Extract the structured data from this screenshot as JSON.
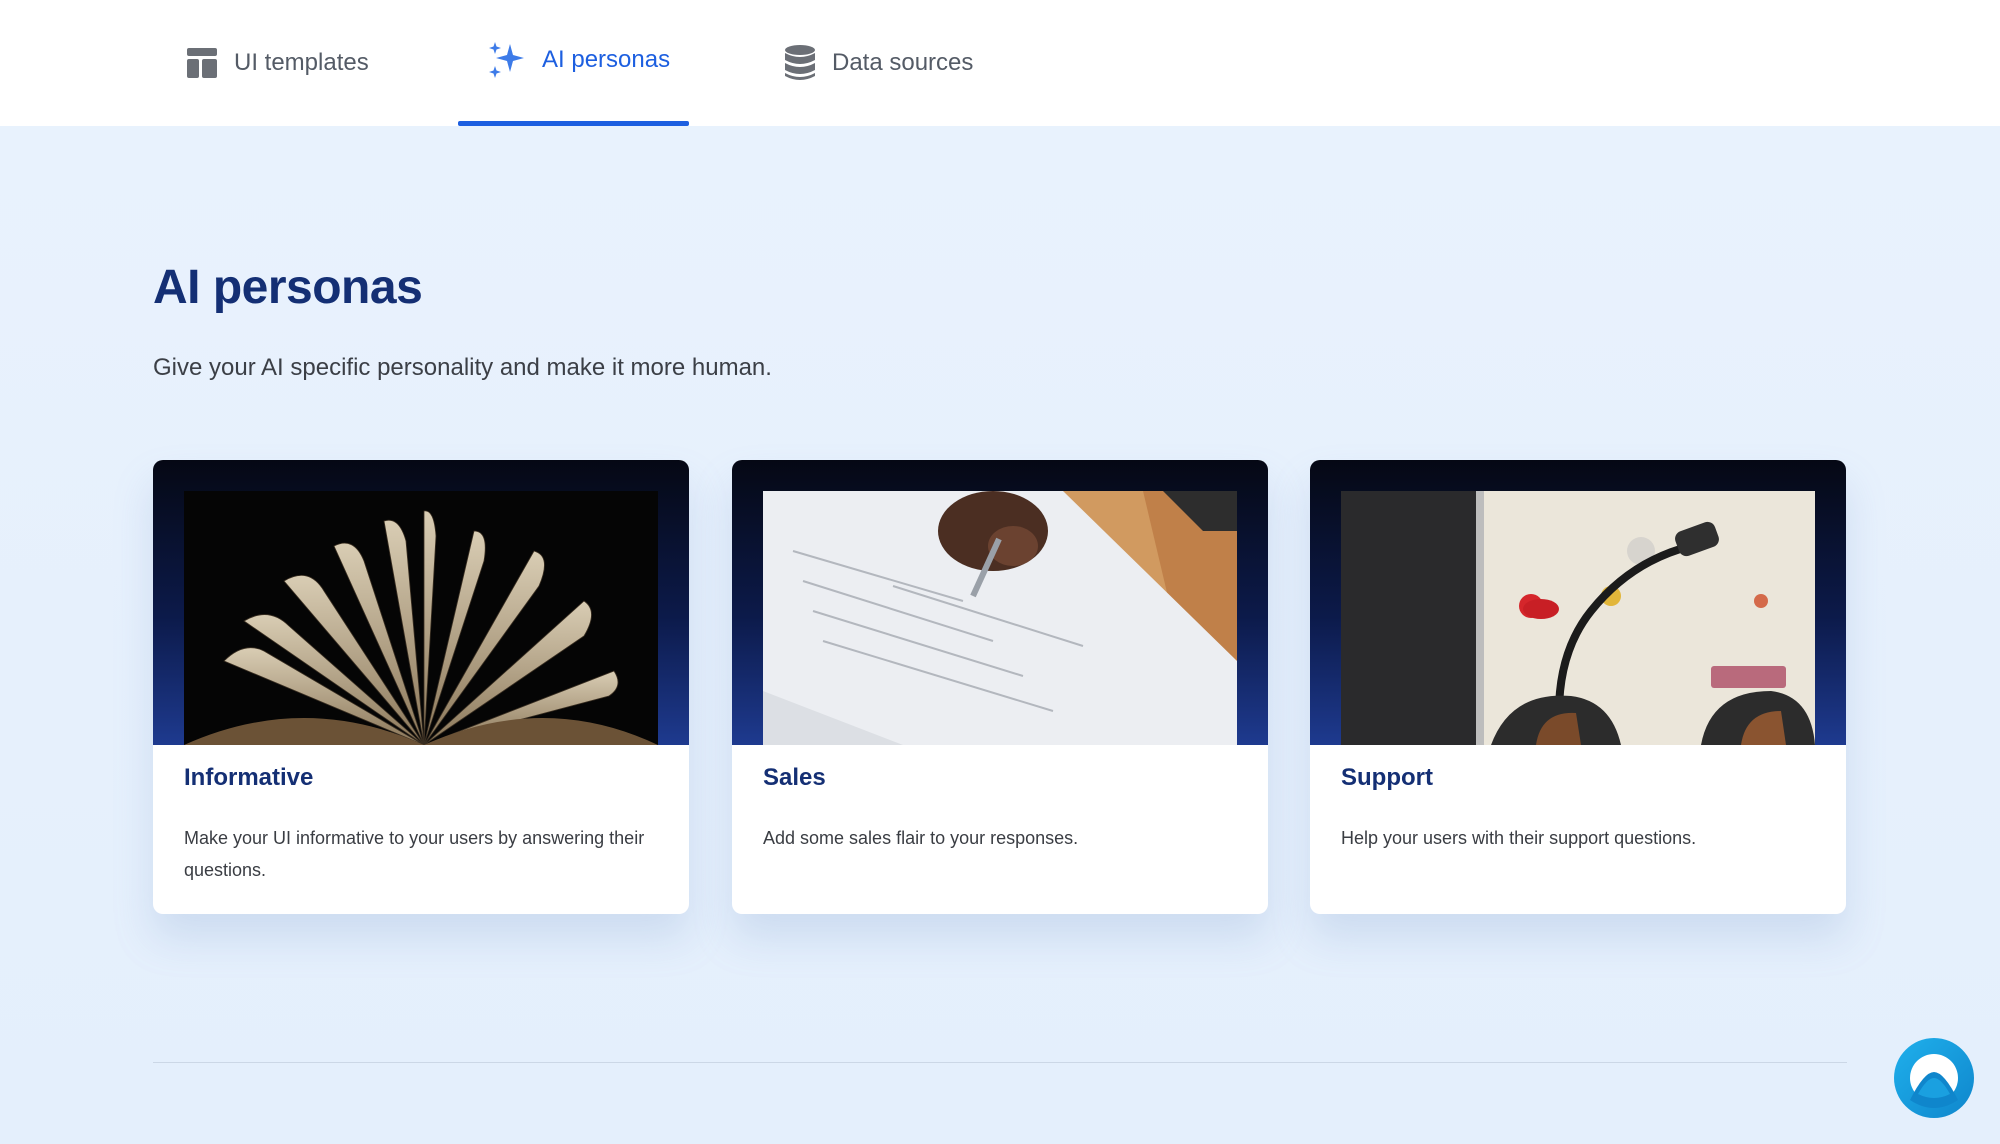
{
  "tabs": [
    {
      "label": "UI templates",
      "icon": "layout-template-icon"
    },
    {
      "label": "AI personas",
      "icon": "sparkles-icon",
      "active": true
    },
    {
      "label": "Data sources",
      "icon": "database-icon"
    }
  ],
  "main": {
    "title": "AI personas",
    "subtitle": "Give your AI specific personality and make it more human."
  },
  "cards": [
    {
      "title": "Informative",
      "description": "Make your UI informative to your users by answering their questions.",
      "image": "open-book-photo"
    },
    {
      "title": "Sales",
      "description": "Add some sales flair to your responses.",
      "image": "signing-document-photo"
    },
    {
      "title": "Support",
      "description": "Help your users with their support questions.",
      "image": "headset-photo"
    }
  ],
  "colors": {
    "accent": "#1d5fe0",
    "heading": "#142f74",
    "background": "#e9f2fd",
    "chat_button": "#1aa0e0"
  },
  "chat_widget": {
    "icon": "chat-logo-icon"
  }
}
